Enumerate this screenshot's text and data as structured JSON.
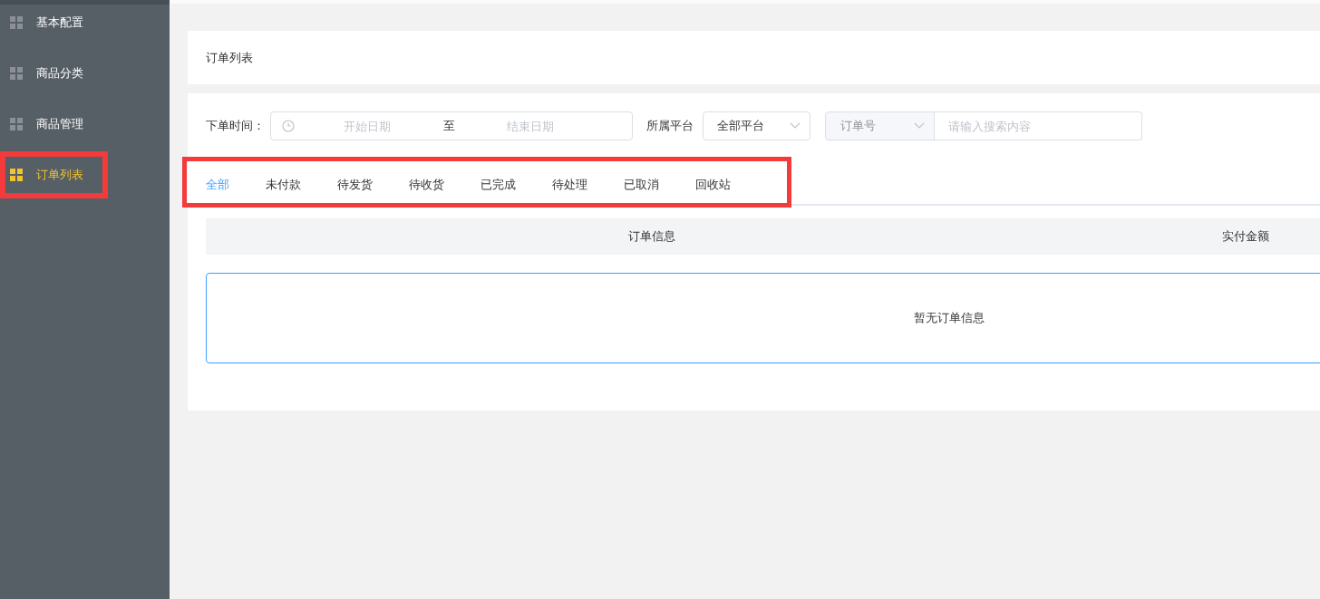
{
  "sidebar": {
    "items": [
      {
        "label": "基本配置",
        "selected": false,
        "highlighted": false
      },
      {
        "label": "商品分类",
        "selected": false,
        "highlighted": false
      },
      {
        "label": "商品管理",
        "selected": false,
        "highlighted": false
      },
      {
        "label": "订单列表",
        "selected": true,
        "highlighted": true
      }
    ]
  },
  "page_title": "订单列表",
  "filters": {
    "order_time_label": "下单时间：",
    "start_placeholder": "开始日期",
    "range_separator": "至",
    "end_placeholder": "结束日期",
    "platform_label": "所属平台",
    "platform_value": "全部平台",
    "search_type": "订单号",
    "search_placeholder": "请输入搜索内容"
  },
  "tabs_highlighted": true,
  "tabs": [
    {
      "label": "全部",
      "selected": true
    },
    {
      "label": "未付款",
      "selected": false
    },
    {
      "label": "待发货",
      "selected": false
    },
    {
      "label": "待收货",
      "selected": false
    },
    {
      "label": "已完成",
      "selected": false
    },
    {
      "label": "待处理",
      "selected": false
    },
    {
      "label": "已取消",
      "selected": false
    },
    {
      "label": "回收站",
      "selected": false
    }
  ],
  "table": {
    "columns": [
      "订单信息",
      "实付金额"
    ],
    "empty_text": "暂无订单信息"
  }
}
